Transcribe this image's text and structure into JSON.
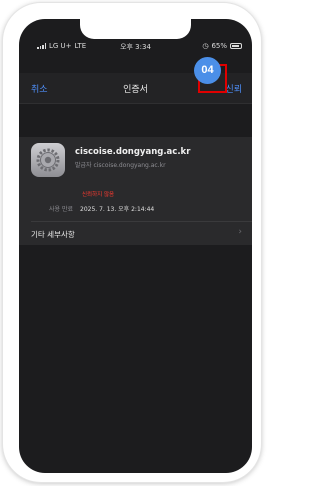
{
  "status_bar": {
    "carrier": "LG U+",
    "network": "LTE",
    "time": "오후 3:34",
    "battery_percent": "65%"
  },
  "nav": {
    "cancel_label": "취소",
    "title": "인증서",
    "trust_label": "신뢰"
  },
  "annotation": {
    "step_number": "04"
  },
  "certificate": {
    "name": "ciscoise.dongyang.ac.kr",
    "issuer_line": "발급자 ciscoise.dongyang.ac.kr",
    "trust_status": "신뢰하지 않음",
    "expiry_label": "사용 만료",
    "expiry_value": "2025. 7. 13. 오후 2:14:44"
  },
  "details": {
    "label": "기타 세부사항"
  },
  "colors": {
    "accent_blue": "#4e8ef7",
    "untrusted_red": "#ff3b30",
    "badge_blue": "#4b8fe8",
    "highlight_red": "#e00000"
  }
}
